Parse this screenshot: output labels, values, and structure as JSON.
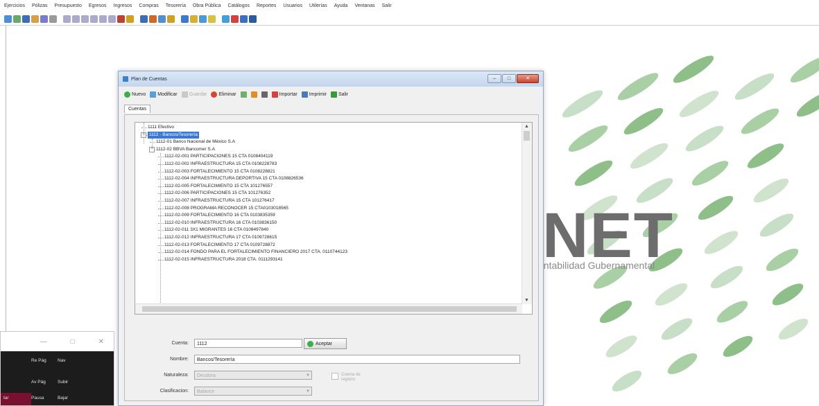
{
  "menu": [
    "Ejercicios",
    "Pólizas",
    "Presupuesto",
    "Egresos",
    "Ingresos",
    "Compras",
    "Tesorería",
    "Obra Pública",
    "Catálogos",
    "Reportes",
    "Usuarios",
    "Utilerías",
    "Ayuda",
    "Ventanas",
    "Salir"
  ],
  "logo": {
    "text": "NET",
    "subtitle": "ontabilidad Gubernamental"
  },
  "mini_window": {
    "keys": [
      "Re Pág",
      "Nav",
      "Av Pág",
      "Subir",
      "Pausa",
      "Bajar",
      "tar"
    ]
  },
  "dialog": {
    "title": "Plan de Cuentas",
    "toolbar": {
      "nuevo": "Nuevo",
      "modificar": "Modificar",
      "guardar": "Guardar",
      "eliminar": "Eliminar",
      "importar": "Importar",
      "imprimir": "Imprimir",
      "salir": "Salir"
    },
    "tab": "Cuentas",
    "tree": [
      {
        "label": "1111  Efectivo",
        "level": 1
      },
      {
        "label": "1112 - Bancos/Tesorería",
        "level": 1,
        "selected": true
      },
      {
        "label": "1112-01  Banco Nacional de México S.A",
        "level": 2
      },
      {
        "label": "1112-02  BBVA Bancomer S.A",
        "level": 2
      },
      {
        "label": "1112-02-001  PARTICIPACIONES 15 CTA 0108404119",
        "level": 3
      },
      {
        "label": "1112-02-002  INFRAESTRUCTURA 15 CTA 0108228783",
        "level": 3
      },
      {
        "label": "1112-02-003  FORTALECIMIENTO 15 CTA 0108228821",
        "level": 3
      },
      {
        "label": "1112-02-004  INFRAESTRUCTURA DEPORTIVA 15 CTA 0108826536",
        "level": 3
      },
      {
        "label": "1112-02-005  FORTALECIMIENTO 15 CTA 101276557",
        "level": 3
      },
      {
        "label": "1112-02-006  PARTICIPACIONES 15 CTA 101276352",
        "level": 3
      },
      {
        "label": "1112-02-007  INFRAESTRUCTURA 15 CTA 101276417",
        "level": 3
      },
      {
        "label": "1112-02-008  PROGRAMA RECONOCER 15 CTA0103018565",
        "level": 3
      },
      {
        "label": "1112-02-009  FORTALECIMIENTO 16 CTA 0103835359",
        "level": 3
      },
      {
        "label": "1112-02-010  INFRAESTRUCTURA 16 CTA 0103836150",
        "level": 3
      },
      {
        "label": "1112-02-011  3X1 MIGRANTES 16 CTA 0108497840",
        "level": 3
      },
      {
        "label": "1112-02-012  INFRAESTRUCTURA 17  CTA 0109728615",
        "level": 3
      },
      {
        "label": "1112-02-013  FORTALECIMIENTO 17 CTA 0109728872",
        "level": 3
      },
      {
        "label": "1112-02-014  FONDO PARA EL FORTALECIMIENTO FINANCIERO 2017 CTA. 0110744123",
        "level": 3
      },
      {
        "label": "1112-02-015  INFRAESTRUCTURA 2018 CTA. 0111293141",
        "level": 3
      }
    ],
    "form": {
      "cuenta_label": "Cuenta:",
      "cuenta_value": "1112",
      "aceptar": "Aceptar",
      "nombre_label": "Nombre:",
      "nombre_value": "Bancos/Tesorería",
      "naturaleza_label": "Naturaleza:",
      "naturaleza_value": "Deudora",
      "clasificacion_label": "Clasificacion:",
      "clasificacion_value": "Balance",
      "checkbox_label": "Cuenta de registro"
    }
  }
}
